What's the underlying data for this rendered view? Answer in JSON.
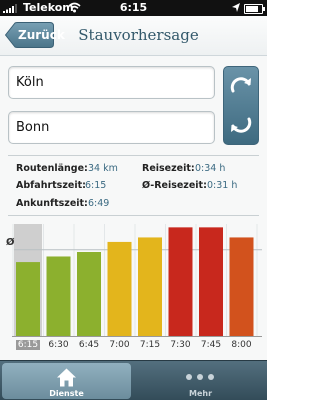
{
  "status_bar": {
    "carrier": "Telekom",
    "time": "6:15"
  },
  "nav": {
    "back_label": "Zurück",
    "title": "Stauvorhersage"
  },
  "route": {
    "from": "Köln",
    "to": "Bonn"
  },
  "info": {
    "route_length_label": "Routenlänge:",
    "route_length_value": "34 km",
    "departure_label": "Abfahrtszeit:",
    "departure_value": "6:15",
    "arrival_label": "Ankunftszeit:",
    "arrival_value": "6:49",
    "travel_time_label": "Reisezeit:",
    "travel_time_value": "0:34 h",
    "avg_travel_time_label": "Ø-Reisezeit:",
    "avg_travel_time_value": "0:31 h"
  },
  "chart_data": {
    "type": "bar",
    "average_label": "Ø",
    "categories": [
      "6:15",
      "6:30",
      "6:45",
      "7:00",
      "7:15",
      "7:30",
      "7:45",
      "8:00"
    ],
    "values": [
      0.66,
      0.71,
      0.75,
      0.84,
      0.88,
      0.97,
      0.97,
      0.88
    ],
    "average": 0.77,
    "colors": [
      "#8cb02e",
      "#8cb02e",
      "#8cb02e",
      "#e3b51c",
      "#e3b51c",
      "#c8281d",
      "#c8281d",
      "#d2521d"
    ],
    "selected_index": 0
  },
  "tabs": [
    {
      "label": "Dienste",
      "icon": "home-icon",
      "active": true
    },
    {
      "label": "Mehr",
      "icon": "more-dots-icon",
      "active": false
    }
  ]
}
